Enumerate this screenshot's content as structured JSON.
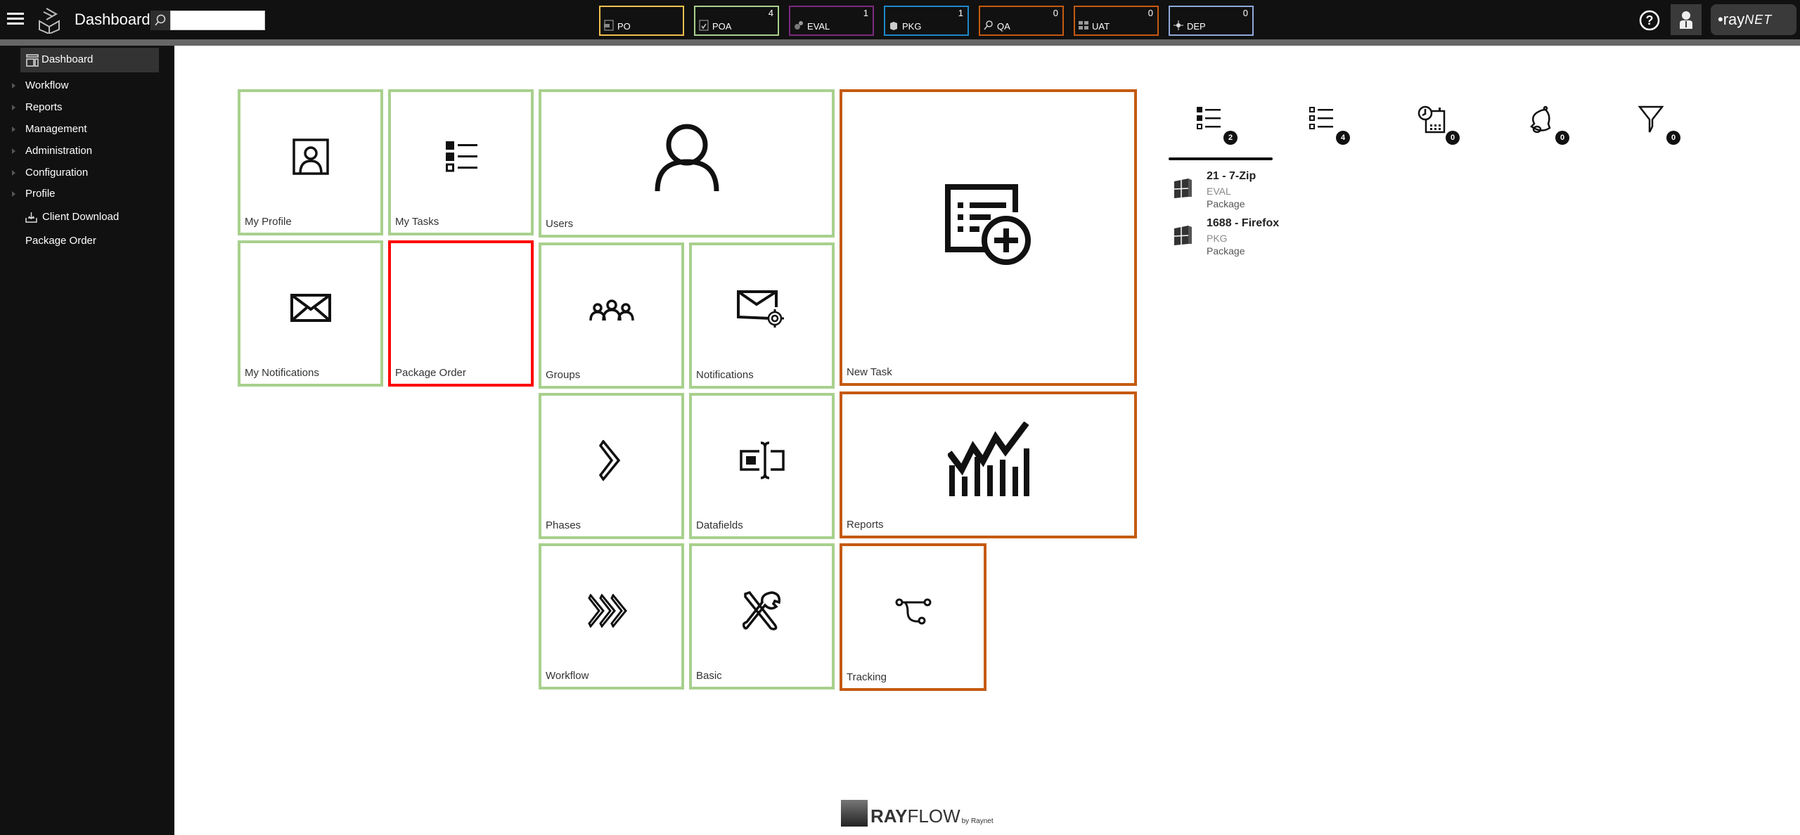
{
  "header": {
    "title": "Dashboard",
    "search": {
      "value": "",
      "placeholder": ""
    },
    "phases": [
      {
        "label": "PO",
        "count": "",
        "color": "#f2c14e",
        "icon": "po-icon"
      },
      {
        "label": "POA",
        "count": "4",
        "color": "#a8d08d",
        "icon": "poa-icon"
      },
      {
        "label": "EVAL",
        "count": "1",
        "color": "#7b2a7f",
        "icon": "eval-gears-icon"
      },
      {
        "label": "PKG",
        "count": "1",
        "color": "#1e88c8",
        "icon": "pkg-box-icon"
      },
      {
        "label": "QA",
        "count": "0",
        "color": "#c55a11",
        "icon": "qa-magnifier-icon"
      },
      {
        "label": "UAT",
        "count": "0",
        "color": "#c55a11",
        "icon": "uat-checks-icon"
      },
      {
        "label": "DEP",
        "count": "0",
        "color": "#8fa9d9",
        "icon": "dep-deploy-icon"
      }
    ],
    "brand": {
      "prefix": "•ray",
      "suffix": "NET"
    }
  },
  "sidebar": {
    "items": [
      {
        "label": "Dashboard",
        "active": true,
        "expandable": false
      },
      {
        "label": "Workflow",
        "expandable": true
      },
      {
        "label": "Reports",
        "expandable": true
      },
      {
        "label": "Management",
        "expandable": true
      },
      {
        "label": "Administration",
        "expandable": true
      },
      {
        "label": "Configuration",
        "expandable": true
      },
      {
        "label": "Profile",
        "expandable": true
      },
      {
        "label": "Client Download",
        "expandable": false
      },
      {
        "label": "Package Order",
        "expandable": false
      }
    ]
  },
  "tiles": [
    {
      "label": "My Profile",
      "color": "green",
      "icon": "profile-card-icon"
    },
    {
      "label": "My Tasks",
      "color": "green",
      "icon": "task-list-icon"
    },
    {
      "label": "Users",
      "color": "green",
      "icon": "user-icon"
    },
    {
      "label": "New Task",
      "color": "orange",
      "icon": "new-task-icon"
    },
    {
      "label": "My Notifications",
      "color": "green",
      "icon": "envelope-icon"
    },
    {
      "label": "Package Order",
      "color": "red",
      "icon": ""
    },
    {
      "label": "Groups",
      "color": "green",
      "icon": "group-icon"
    },
    {
      "label": "Notifications",
      "color": "green",
      "icon": "mail-settings-icon"
    },
    {
      "label": "Phases",
      "color": "green",
      "icon": "chevron-right-icon"
    },
    {
      "label": "Datafields",
      "color": "green",
      "icon": "text-field-icon"
    },
    {
      "label": "Reports",
      "color": "orange",
      "icon": "chart-icon"
    },
    {
      "label": "Workflow",
      "color": "green",
      "icon": "triple-chevron-icon"
    },
    {
      "label": "Basic",
      "color": "green",
      "icon": "tools-icon"
    },
    {
      "label": "Tracking",
      "color": "orange",
      "icon": "route-icon"
    }
  ],
  "colors": {
    "green": "#a8d08d",
    "orange": "#c55a11",
    "red": "#ff0000"
  },
  "right_panel": {
    "tabs": [
      {
        "icon": "my-tasks-list-icon",
        "count": "2",
        "active": true
      },
      {
        "icon": "all-tasks-list-icon",
        "count": "4"
      },
      {
        "icon": "schedule-icon",
        "count": "0"
      },
      {
        "icon": "bell-icon",
        "count": "0"
      },
      {
        "icon": "filter-icon",
        "count": "0"
      }
    ],
    "tasks": [
      {
        "title": "21 - 7-Zip",
        "phase": "EVAL",
        "type": "Package"
      },
      {
        "title": "1688 - Firefox",
        "phase": "PKG",
        "type": "Package"
      }
    ]
  },
  "footer": {
    "brand_bold": "RAY",
    "brand_light": "FLOW",
    "by": "by Raynet"
  }
}
